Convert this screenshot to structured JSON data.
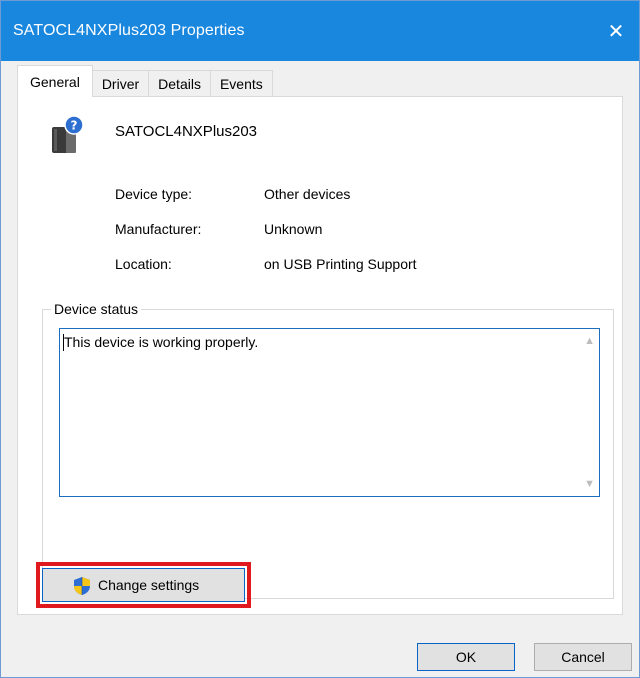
{
  "window": {
    "title": "SATOCL4NXPlus203  Properties",
    "close_glyph": "✕",
    "accent_color": "#1a87df"
  },
  "tabs": [
    {
      "label": "General",
      "active": true
    },
    {
      "label": "Driver",
      "active": false
    },
    {
      "label": "Details",
      "active": false
    },
    {
      "label": "Events",
      "active": false
    }
  ],
  "device": {
    "icon": "unknown-device-icon",
    "name": "SATOCL4NXPlus203",
    "properties": [
      {
        "label": "Device type:",
        "value": "Other devices"
      },
      {
        "label": "Manufacturer:",
        "value": "Unknown"
      },
      {
        "label": "Location:",
        "value": "on USB Printing Support"
      }
    ]
  },
  "status": {
    "group_label": "Device status",
    "text": "This device is working properly."
  },
  "buttons": {
    "change_settings": "Change settings",
    "change_settings_icon": "uac-shield-icon",
    "ok": "OK",
    "cancel": "Cancel"
  }
}
